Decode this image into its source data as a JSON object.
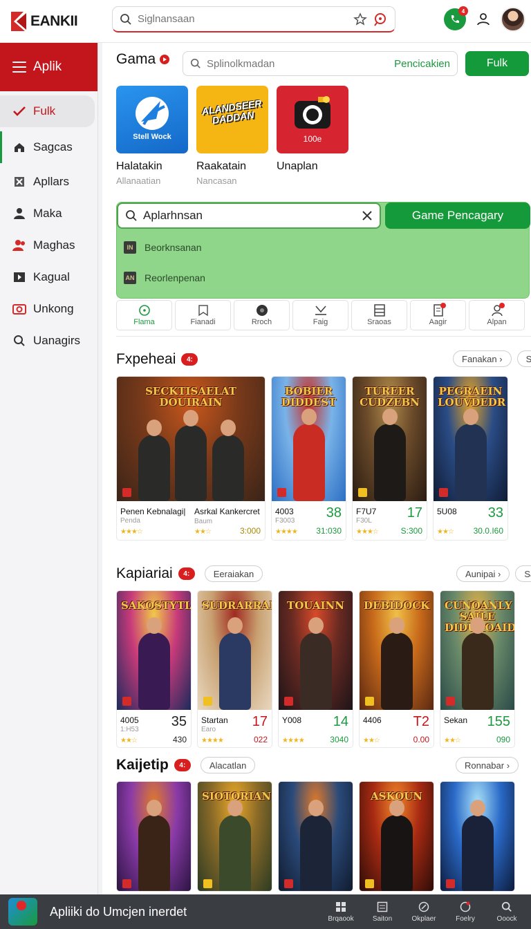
{
  "colors": {
    "brand_red": "#c3161c",
    "accent_green": "#149a3a",
    "suggest_bg": "#8fd68a",
    "bottom_bar": "#3a3d42"
  },
  "app": {
    "logo_text": "EANKII"
  },
  "topbar": {
    "search_placeholder": "Siglnansaan",
    "icons": [
      "search-icon",
      "pin-icon",
      "location-icon",
      "phone-icon",
      "user-icon",
      "avatar"
    ],
    "notification_count": "4"
  },
  "sidebar": {
    "header": "Aplik",
    "items": [
      {
        "label": "Fulk",
        "icon": "check-icon"
      },
      {
        "label": "Sagcas",
        "icon": "home-icon"
      },
      {
        "label": "Apllars",
        "icon": "grid-x-icon"
      },
      {
        "label": "Maka",
        "icon": "user-icon"
      },
      {
        "label": "Maghas",
        "icon": "people-icon"
      },
      {
        "label": "Kagual",
        "icon": "play-icon"
      },
      {
        "label": "Unkong",
        "icon": "camera-icon"
      },
      {
        "label": "Uanagirs",
        "icon": "search-icon"
      }
    ]
  },
  "main": {
    "title": "Gama",
    "search_placeholder": "Splinolkmadan",
    "search_hint": "Pencicakien",
    "search_button": "Fulk",
    "apps": [
      {
        "name": "Halatakin",
        "sub": "Allanaatian",
        "tile_text": "Stell Wock",
        "color": "#1e7fe0"
      },
      {
        "name": "Raakatain",
        "sub": "Nancasan",
        "tile_text": "ALANDSEER DADDAN",
        "color": "#f5b613"
      },
      {
        "name": "Unaplan",
        "sub": "",
        "tile_text": "100e",
        "color": "#d62430"
      }
    ],
    "search3": {
      "value": "Aplarhnsan",
      "button": "Game Pencagary",
      "suggestions": [
        {
          "text": "Beorknsanan",
          "tag": "IN"
        },
        {
          "text": "Reorlenpenan",
          "tag": "AN"
        }
      ]
    },
    "categories": [
      {
        "label": "Flama",
        "icon": "clock-icon"
      },
      {
        "label": "Fianadi",
        "icon": "bookmark-icon"
      },
      {
        "label": "Rroch",
        "icon": "disc-icon"
      },
      {
        "label": "Faig",
        "icon": "check-down-icon"
      },
      {
        "label": "Sraoas",
        "icon": "list-icon"
      },
      {
        "label": "Aagir",
        "icon": "doc-icon"
      },
      {
        "label": "Alpan",
        "icon": "person-icon"
      }
    ],
    "sections": [
      {
        "title": "Fxpeheai",
        "badge": "4:",
        "chip": "",
        "right_chip": "Fanakan",
        "cut_chip": "Sa",
        "cards": [
          {
            "title": "SECKTISAELAT DOUIRAIN",
            "name": "Penen Kebnalagi|",
            "sub": "Penda",
            "big": "",
            "count": "3:000",
            "stars": "★★★☆",
            "color_class": "y",
            "wide": true,
            "palette": [
              "#3a2418",
              "#7a3a1a",
              "#c9581c"
            ],
            "fig": "#2a2a28"
          },
          {
            "title": "",
            "name": "Asrkal Kankercret",
            "sub": "Baum",
            "big": "",
            "count": "",
            "stars": "★★☆",
            "color_class": "k",
            "wide": false,
            "hidden": true
          },
          {
            "title": "BOBIER DIDDEST",
            "name": "4003",
            "sub": "F3003",
            "big": "38",
            "count": "31:030",
            "stars": "★★★★",
            "color_class": "g",
            "wide": false,
            "palette": [
              "#2c6fc4",
              "#7ab3e8",
              "#c83028"
            ],
            "fig": "#c82c22"
          },
          {
            "title": "TUREER CUDZEBN",
            "name": "F7U7",
            "sub": "F30L",
            "big": "17",
            "count": "S:300",
            "stars": "★★★☆",
            "color_class": "g",
            "wide": false,
            "palette": [
              "#2a1c12",
              "#6a4a2a",
              "#b08a4a"
            ],
            "fig": "#1e1a18"
          },
          {
            "title": "PEGRAEIN LOUVDEDR",
            "name": "5U08",
            "sub": "",
            "big": "33",
            "count": "30.0.I60",
            "stars": "★★☆",
            "color_class": "g",
            "wide": false,
            "palette": [
              "#101c34",
              "#2a4c86",
              "#e0a028"
            ],
            "fig": "#223252"
          }
        ]
      },
      {
        "title": "Kapiariai",
        "badge": "4:",
        "chip": "Eeraiakan",
        "right_chip": "Aunipai",
        "cut_chip": "Sa",
        "cards": [
          {
            "title": "SAKOSTYTIAN",
            "name": "4005",
            "sub": "1:H53",
            "big": "35",
            "count": "430",
            "stars": "★★☆",
            "color_class": "k",
            "palette": [
              "#1c2a5c",
              "#c83a7a",
              "#f0c848"
            ],
            "fig": "#3a1a52"
          },
          {
            "title": "SUDRARRAN",
            "name": "Startan",
            "sub": "Earo",
            "big": "17",
            "count": "022",
            "stars": "★★★★",
            "color_class": "r",
            "palette": [
              "#e8d8c0",
              "#c8a070",
              "#a02a20"
            ],
            "fig": "#2a3a62"
          },
          {
            "title": "TOUAINN",
            "name": "Y008",
            "sub": "",
            "big": "14",
            "count": "3040",
            "stars": "★★★★",
            "color_class": "g",
            "palette": [
              "#1c1418",
              "#6a2a22",
              "#d84a2a"
            ],
            "fig": "#3a2c24"
          },
          {
            "title": "DEBIDOCK",
            "name": "4406",
            "sub": "",
            "big": "T2",
            "count": "0.00",
            "stars": "★★☆",
            "color_class": "r",
            "palette": [
              "#5a2812",
              "#c86a1a",
              "#f0c048"
            ],
            "fig": "#2a1c14"
          },
          {
            "title": "CUNOANLY SAILE DIDUROAIDE",
            "name": "Sekan",
            "sub": "",
            "big": "155",
            "count": "090",
            "stars": "★★☆",
            "color_class": "g",
            "palette": [
              "#2a4a48",
              "#6a8a6a",
              "#e0b048"
            ],
            "fig": "#3a2a1c"
          }
        ]
      },
      {
        "title": "Kaijetip",
        "badge": "4:",
        "chip": "Alacatlan",
        "right_chip": "Ronnabar",
        "cut_chip": "",
        "cards": [
          {
            "title": "",
            "palette": [
              "#2a1440",
              "#8a3aa8",
              "#e07a2a"
            ],
            "fig": "#3a2418"
          },
          {
            "title": "SIOTORIAN",
            "palette": [
              "#2a3a22",
              "#8a6a28",
              "#e8a828"
            ],
            "fig": "#3a4a2a"
          },
          {
            "title": "",
            "palette": [
              "#101a2c",
              "#2a4a7a",
              "#e07a2a"
            ],
            "fig": "#1c2438"
          },
          {
            "title": "ASKOUN",
            "palette": [
              "#2a0c08",
              "#a82a12",
              "#f0862a"
            ],
            "fig": "#181414"
          },
          {
            "title": "",
            "palette": [
              "#0c1a3a",
              "#2a6ac8",
              "#a8e0f8"
            ],
            "fig": "#1a223a"
          }
        ]
      }
    ]
  },
  "bottombar": {
    "text": "Apliiki do Umcjen inerdet",
    "items": [
      {
        "label": "Brqaook",
        "icon": "grid-icon"
      },
      {
        "label": "Saiton",
        "icon": "tablet-icon"
      },
      {
        "label": "Okplaer",
        "icon": "brush-icon"
      },
      {
        "label": "Foelry",
        "icon": "feather-icon"
      },
      {
        "label": "Ooock",
        "icon": "search-icon"
      }
    ]
  }
}
